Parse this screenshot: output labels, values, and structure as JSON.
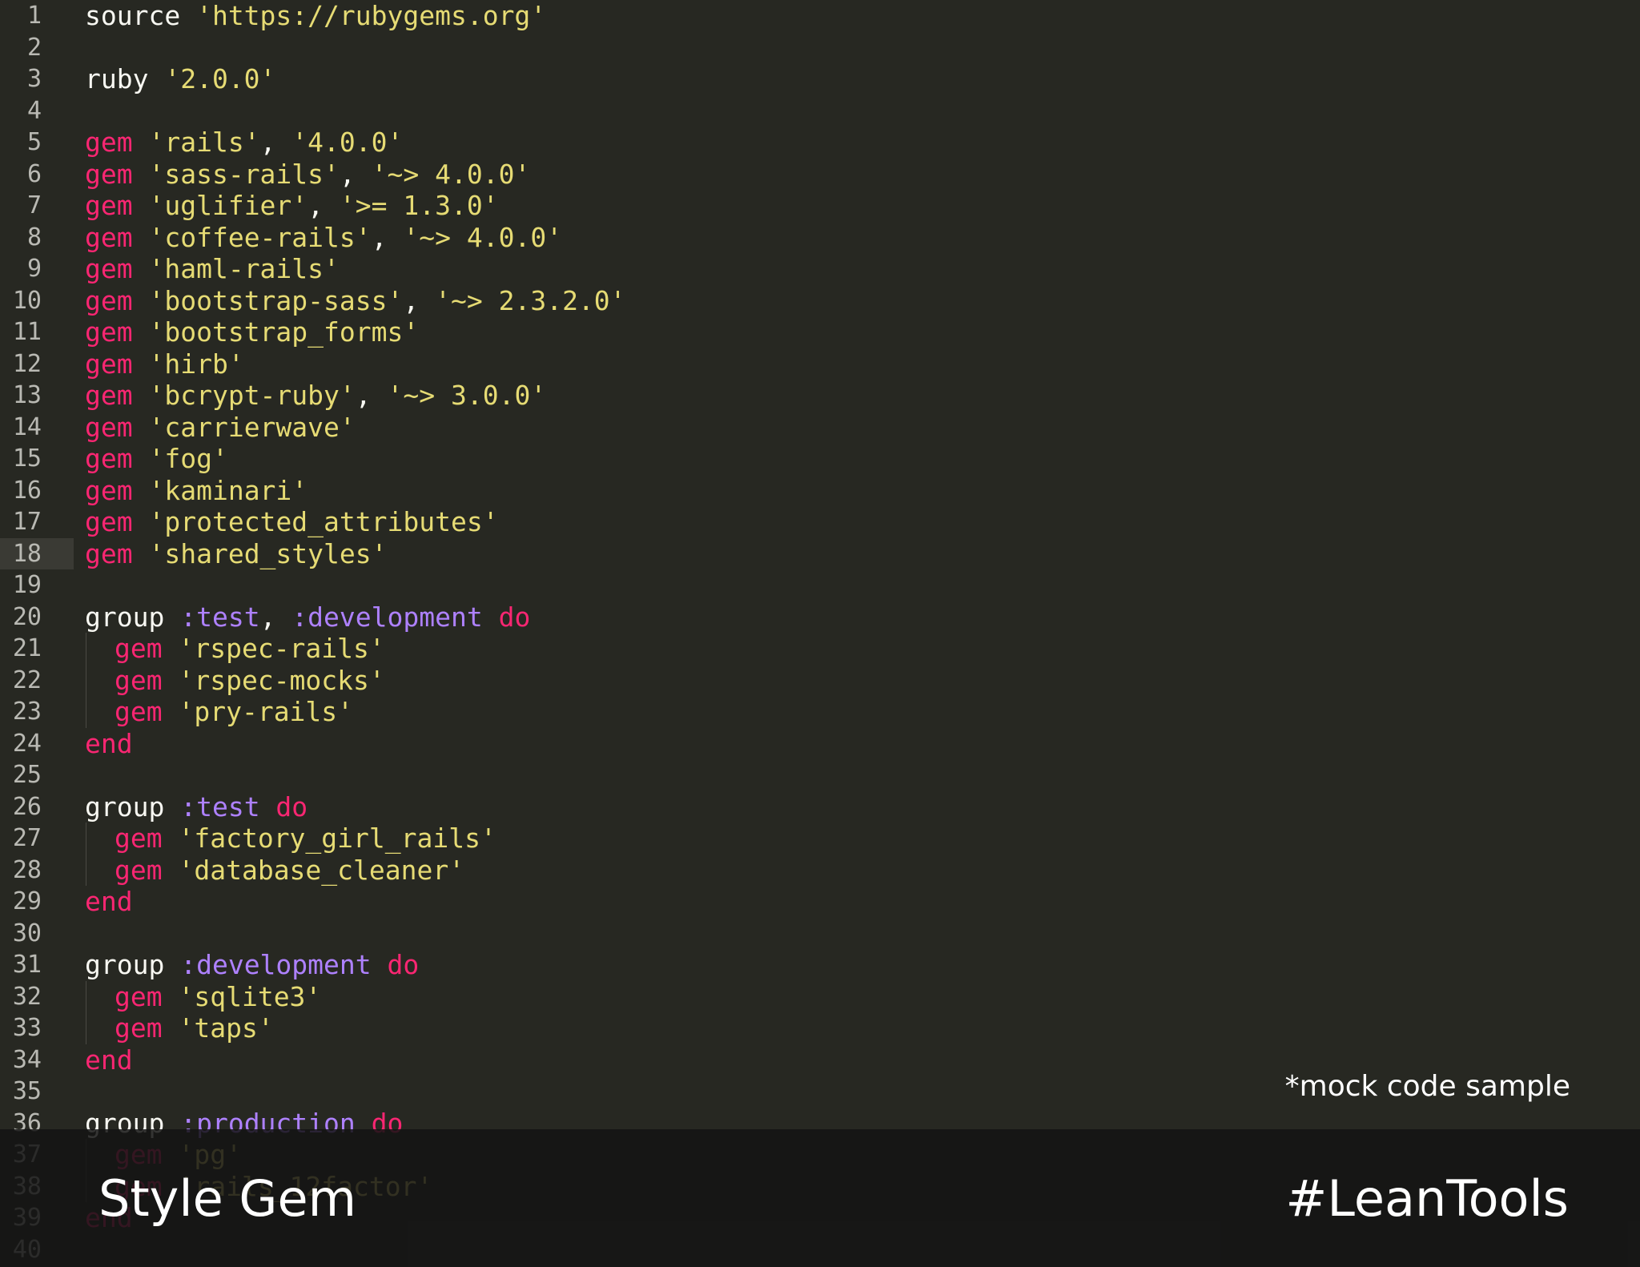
{
  "editor": {
    "current_line": 18,
    "lines": [
      {
        "n": "1",
        "indent": 0,
        "tokens": [
          [
            "plain",
            "source "
          ],
          [
            "str",
            "'https://rubygems.org'"
          ]
        ]
      },
      {
        "n": "2",
        "indent": 0,
        "tokens": []
      },
      {
        "n": "3",
        "indent": 0,
        "tokens": [
          [
            "plain",
            "ruby "
          ],
          [
            "str",
            "'2.0.0'"
          ]
        ]
      },
      {
        "n": "4",
        "indent": 0,
        "tokens": []
      },
      {
        "n": "5",
        "indent": 0,
        "tokens": [
          [
            "kw",
            "gem "
          ],
          [
            "str",
            "'rails'"
          ],
          [
            "plain",
            ", "
          ],
          [
            "str",
            "'4.0.0'"
          ]
        ]
      },
      {
        "n": "6",
        "indent": 0,
        "tokens": [
          [
            "kw",
            "gem "
          ],
          [
            "str",
            "'sass-rails'"
          ],
          [
            "plain",
            ", "
          ],
          [
            "str",
            "'~> 4.0.0'"
          ]
        ]
      },
      {
        "n": "7",
        "indent": 0,
        "tokens": [
          [
            "kw",
            "gem "
          ],
          [
            "str",
            "'uglifier'"
          ],
          [
            "plain",
            ", "
          ],
          [
            "str",
            "'>= 1.3.0'"
          ]
        ]
      },
      {
        "n": "8",
        "indent": 0,
        "tokens": [
          [
            "kw",
            "gem "
          ],
          [
            "str",
            "'coffee-rails'"
          ],
          [
            "plain",
            ", "
          ],
          [
            "str",
            "'~> 4.0.0'"
          ]
        ]
      },
      {
        "n": "9",
        "indent": 0,
        "tokens": [
          [
            "kw",
            "gem "
          ],
          [
            "str",
            "'haml-rails'"
          ]
        ]
      },
      {
        "n": "10",
        "indent": 0,
        "tokens": [
          [
            "kw",
            "gem "
          ],
          [
            "str",
            "'bootstrap-sass'"
          ],
          [
            "plain",
            ", "
          ],
          [
            "str",
            "'~> 2.3.2.0'"
          ]
        ]
      },
      {
        "n": "11",
        "indent": 0,
        "tokens": [
          [
            "kw",
            "gem "
          ],
          [
            "str",
            "'bootstrap_forms'"
          ]
        ]
      },
      {
        "n": "12",
        "indent": 0,
        "tokens": [
          [
            "kw",
            "gem "
          ],
          [
            "str",
            "'hirb'"
          ]
        ]
      },
      {
        "n": "13",
        "indent": 0,
        "tokens": [
          [
            "kw",
            "gem "
          ],
          [
            "str",
            "'bcrypt-ruby'"
          ],
          [
            "plain",
            ", "
          ],
          [
            "str",
            "'~> 3.0.0'"
          ]
        ]
      },
      {
        "n": "14",
        "indent": 0,
        "tokens": [
          [
            "kw",
            "gem "
          ],
          [
            "str",
            "'carrierwave'"
          ]
        ]
      },
      {
        "n": "15",
        "indent": 0,
        "tokens": [
          [
            "kw",
            "gem "
          ],
          [
            "str",
            "'fog'"
          ]
        ]
      },
      {
        "n": "16",
        "indent": 0,
        "tokens": [
          [
            "kw",
            "gem "
          ],
          [
            "str",
            "'kaminari'"
          ]
        ]
      },
      {
        "n": "17",
        "indent": 0,
        "tokens": [
          [
            "kw",
            "gem "
          ],
          [
            "str",
            "'protected_attributes'"
          ]
        ]
      },
      {
        "n": "18",
        "indent": 0,
        "tokens": [
          [
            "kw",
            "gem "
          ],
          [
            "str",
            "'shared_styles'"
          ]
        ]
      },
      {
        "n": "19",
        "indent": 0,
        "tokens": []
      },
      {
        "n": "20",
        "indent": 0,
        "tokens": [
          [
            "plain",
            "group "
          ],
          [
            "sym",
            ":test"
          ],
          [
            "plain",
            ", "
          ],
          [
            "sym",
            ":development"
          ],
          [
            "kw",
            " do"
          ]
        ]
      },
      {
        "n": "21",
        "indent": 1,
        "tokens": [
          [
            "kw",
            "gem "
          ],
          [
            "str",
            "'rspec-rails'"
          ]
        ]
      },
      {
        "n": "22",
        "indent": 1,
        "tokens": [
          [
            "kw",
            "gem "
          ],
          [
            "str",
            "'rspec-mocks'"
          ]
        ]
      },
      {
        "n": "23",
        "indent": 1,
        "tokens": [
          [
            "kw",
            "gem "
          ],
          [
            "str",
            "'pry-rails'"
          ]
        ]
      },
      {
        "n": "24",
        "indent": 0,
        "tokens": [
          [
            "kw",
            "end"
          ]
        ]
      },
      {
        "n": "25",
        "indent": 0,
        "tokens": []
      },
      {
        "n": "26",
        "indent": 0,
        "tokens": [
          [
            "plain",
            "group "
          ],
          [
            "sym",
            ":test"
          ],
          [
            "kw",
            " do"
          ]
        ]
      },
      {
        "n": "27",
        "indent": 1,
        "tokens": [
          [
            "kw",
            "gem "
          ],
          [
            "str",
            "'factory_girl_rails'"
          ]
        ]
      },
      {
        "n": "28",
        "indent": 1,
        "tokens": [
          [
            "kw",
            "gem "
          ],
          [
            "str",
            "'database_cleaner'"
          ]
        ]
      },
      {
        "n": "29",
        "indent": 0,
        "tokens": [
          [
            "kw",
            "end"
          ]
        ]
      },
      {
        "n": "30",
        "indent": 0,
        "tokens": []
      },
      {
        "n": "31",
        "indent": 0,
        "tokens": [
          [
            "plain",
            "group "
          ],
          [
            "sym",
            ":development"
          ],
          [
            "kw",
            " do"
          ]
        ]
      },
      {
        "n": "32",
        "indent": 1,
        "tokens": [
          [
            "kw",
            "gem "
          ],
          [
            "str",
            "'sqlite3'"
          ]
        ]
      },
      {
        "n": "33",
        "indent": 1,
        "tokens": [
          [
            "kw",
            "gem "
          ],
          [
            "str",
            "'taps'"
          ]
        ]
      },
      {
        "n": "34",
        "indent": 0,
        "tokens": [
          [
            "kw",
            "end"
          ]
        ]
      },
      {
        "n": "35",
        "indent": 0,
        "tokens": []
      },
      {
        "n": "36",
        "indent": 0,
        "tokens": [
          [
            "plain",
            "group "
          ],
          [
            "sym",
            ":production"
          ],
          [
            "kw",
            " do"
          ]
        ]
      },
      {
        "n": "37",
        "indent": 1,
        "tokens": [
          [
            "kw",
            "gem "
          ],
          [
            "str",
            "'pg'"
          ]
        ]
      },
      {
        "n": "38",
        "indent": 1,
        "tokens": [
          [
            "kw",
            "gem "
          ],
          [
            "str",
            "'rails_12factor'"
          ]
        ]
      },
      {
        "n": "39",
        "indent": 0,
        "tokens": [
          [
            "kw",
            "end"
          ]
        ]
      },
      {
        "n": "40",
        "indent": 0,
        "tokens": []
      }
    ]
  },
  "overlay": {
    "note": "*mock code sample",
    "title": "Style Gem",
    "hashtag": "#LeanTools"
  },
  "colors": {
    "background": "#272822",
    "plain": "#f8f8f2",
    "keyword": "#f92672",
    "string": "#e6db74",
    "symbol": "#ae81ff",
    "gutter": "#b9b9b3"
  }
}
